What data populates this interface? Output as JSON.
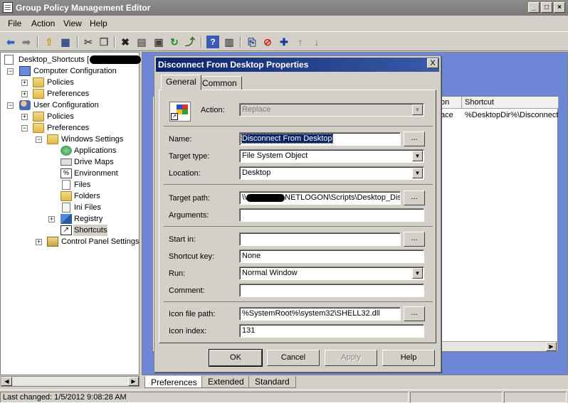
{
  "window": {
    "title": "Group Policy Management Editor"
  },
  "menu": [
    "File",
    "Action",
    "View",
    "Help"
  ],
  "tree": {
    "root": "Desktop_Shortcuts [",
    "computer_configuration": "Computer Configuration",
    "cc_policies": "Policies",
    "cc_preferences": "Preferences",
    "user_configuration": "User Configuration",
    "uc_policies": "Policies",
    "uc_preferences": "Preferences",
    "windows_settings": "Windows Settings",
    "applications": "Applications",
    "drive_maps": "Drive Maps",
    "environment": "Environment",
    "files": "Files",
    "folders": "Folders",
    "ini_files": "Ini Files",
    "registry": "Registry",
    "shortcuts": "Shortcuts",
    "control_panel_settings": "Control Panel Settings"
  },
  "list": {
    "columns": [
      "on",
      "Shortcut"
    ],
    "row": {
      "action": "ace",
      "shortcut": "%DesktopDir%\\Disconnect"
    }
  },
  "bottom_tabs": [
    "Preferences",
    "Extended",
    "Standard"
  ],
  "status": {
    "text": "Last changed: 1/5/2012 9:08:28 AM"
  },
  "dialog": {
    "title": "Disconnect From Desktop Properties",
    "close": "X",
    "tabs": [
      "General",
      "Common"
    ],
    "action_label": "Action:",
    "action_value": "Replace",
    "name_label": "Name:",
    "name_value": "Disconnect From Desktop",
    "target_type_label": "Target type:",
    "target_type_value": "File System Object",
    "location_label": "Location:",
    "location_value": "Desktop",
    "target_path_label": "Target path:",
    "target_path_prefix": "\\\\",
    "target_path_value": "NETLOGON\\Scripts\\Desktop_Disco",
    "arguments_label": "Arguments:",
    "arguments_value": "",
    "start_in_label": "Start in:",
    "start_in_value": "",
    "shortcut_key_label": "Shortcut key:",
    "shortcut_key_value": "None",
    "run_label": "Run:",
    "run_value": "Normal Window",
    "comment_label": "Comment:",
    "comment_value": "",
    "icon_path_label": "Icon file path:",
    "icon_path_value": "%SystemRoot%\\system32\\SHELL32.dll",
    "icon_index_label": "Icon index:",
    "icon_index_value": "131",
    "ellipsis": "...",
    "buttons": {
      "ok": "OK",
      "cancel": "Cancel",
      "apply": "Apply",
      "help": "Help"
    }
  }
}
